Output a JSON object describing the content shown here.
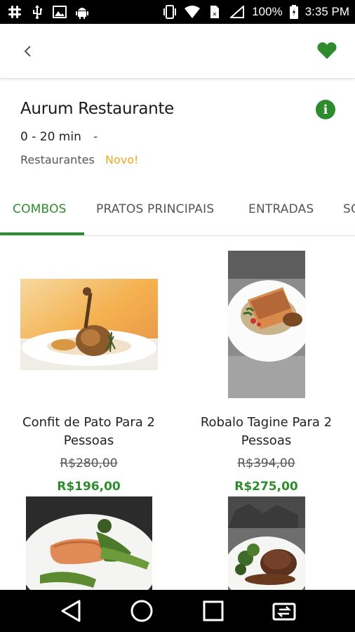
{
  "status_bar": {
    "battery": "100%",
    "time": "3:35 PM",
    "icons_left": [
      "slack-icon",
      "usb-icon",
      "image-icon",
      "android-icon"
    ],
    "icons_right": [
      "vibrate-icon",
      "wifi-icon",
      "signal-icon",
      "battery-icon"
    ]
  },
  "app_bar": {
    "back_icon": "chevron-left-icon",
    "favorite_icon": "heart-icon"
  },
  "restaurant": {
    "name": "Aurum Restaurante",
    "delivery_time": "0 - 20 min",
    "separator": "-",
    "category": "Restaurantes",
    "badge": "Novo!",
    "info_icon": "i"
  },
  "tabs": [
    {
      "label": "COMBOS",
      "active": true
    },
    {
      "label": "PRATOS PRINCIPAIS",
      "active": false
    },
    {
      "label": "ENTRADAS",
      "active": false
    },
    {
      "label": "SO",
      "active": false
    }
  ],
  "products": [
    {
      "title_line1": "Confit de Pato Para 2",
      "title_line2": "Pessoas",
      "old_price": "R$280,00",
      "price": "R$196,00"
    },
    {
      "title_line1": "Robalo Tagine Para 2",
      "title_line2": "Pessoas",
      "old_price": "R$394,00",
      "price": "R$275,00"
    },
    {
      "title_line1": "",
      "title_line2": "",
      "old_price": "",
      "price": ""
    },
    {
      "title_line1": "",
      "title_line2": "",
      "old_price": "",
      "price": ""
    }
  ],
  "colors": {
    "brand_green": "#2e8b2e",
    "badge_orange": "#f0a81e"
  }
}
